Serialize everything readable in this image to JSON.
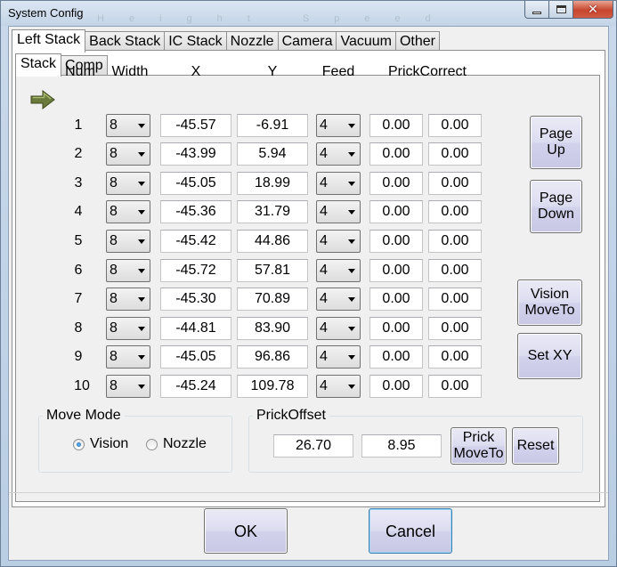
{
  "window": {
    "title": "System Config",
    "title_ghost": "Height Speed Vision Check Done Comment"
  },
  "tabs": [
    "Left Stack",
    "Back Stack",
    "IC Stack",
    "Nozzle",
    "Camera",
    "Vacuum",
    "Other"
  ],
  "subtabs": [
    "Stack",
    "Comp"
  ],
  "table": {
    "headers": {
      "num": "Num",
      "width": "Width",
      "x": "X",
      "y": "Y",
      "feed": "Feed",
      "prick": "PrickCorrect"
    },
    "rows": [
      {
        "num": "1",
        "width": "8",
        "x": "-45.57",
        "y": "-6.91",
        "feed": "4",
        "pc1": "0.00",
        "pc2": "0.00"
      },
      {
        "num": "2",
        "width": "8",
        "x": "-43.99",
        "y": "5.94",
        "feed": "4",
        "pc1": "0.00",
        "pc2": "0.00"
      },
      {
        "num": "3",
        "width": "8",
        "x": "-45.05",
        "y": "18.99",
        "feed": "4",
        "pc1": "0.00",
        "pc2": "0.00"
      },
      {
        "num": "4",
        "width": "8",
        "x": "-45.36",
        "y": "31.79",
        "feed": "4",
        "pc1": "0.00",
        "pc2": "0.00"
      },
      {
        "num": "5",
        "width": "8",
        "x": "-45.42",
        "y": "44.86",
        "feed": "4",
        "pc1": "0.00",
        "pc2": "0.00"
      },
      {
        "num": "6",
        "width": "8",
        "x": "-45.72",
        "y": "57.81",
        "feed": "4",
        "pc1": "0.00",
        "pc2": "0.00"
      },
      {
        "num": "7",
        "width": "8",
        "x": "-45.30",
        "y": "70.89",
        "feed": "4",
        "pc1": "0.00",
        "pc2": "0.00"
      },
      {
        "num": "8",
        "width": "8",
        "x": "-44.81",
        "y": "83.90",
        "feed": "4",
        "pc1": "0.00",
        "pc2": "0.00"
      },
      {
        "num": "9",
        "width": "8",
        "x": "-45.05",
        "y": "96.86",
        "feed": "4",
        "pc1": "0.00",
        "pc2": "0.00"
      },
      {
        "num": "10",
        "width": "8",
        "x": "-45.24",
        "y": "109.78",
        "feed": "4",
        "pc1": "0.00",
        "pc2": "0.00"
      }
    ],
    "current_row_indicator": "arrow-right-icon"
  },
  "side_buttons": {
    "page_up": "Page\nUp",
    "page_down": "Page\nDown",
    "vision_moveto": "Vision\nMoveTo",
    "set_xy": "Set XY"
  },
  "move_mode": {
    "label": "Move Mode",
    "options": [
      "Vision",
      "Nozzle"
    ],
    "selected": "Vision"
  },
  "prick_offset": {
    "label": "PrickOffset",
    "x": "26.70",
    "y": "8.95",
    "prick_moveto": "Prick\nMoveTo",
    "reset": "Reset"
  },
  "footer": {
    "ok": "OK",
    "cancel": "Cancel"
  },
  "colors": {
    "indicator_arrow": "#6b7a3a",
    "client_bg": "#f0f0f0",
    "focus_border": "#3c7fb1"
  }
}
